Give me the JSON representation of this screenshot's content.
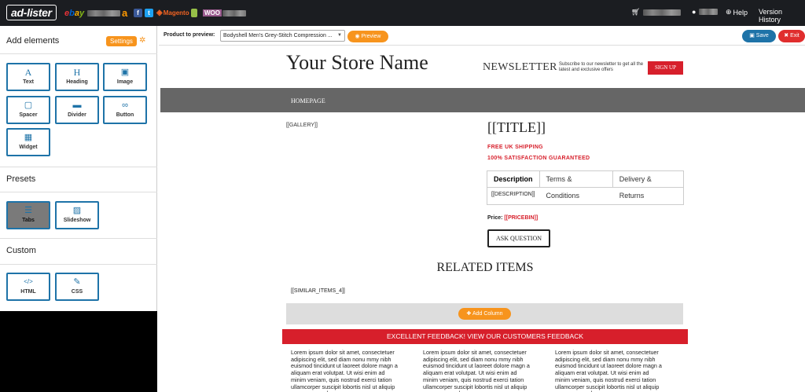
{
  "topbar": {
    "logo": "ad-lister",
    "channels": {
      "ebay": [
        "e",
        "b",
        "a",
        "y"
      ],
      "amazon": "a",
      "magento": "Magento",
      "woo": "WOO"
    },
    "help": "Help",
    "version_history": "Version History"
  },
  "sidebar": {
    "add_elements_title": "Add elements",
    "settings_label": "Settings",
    "elements": [
      {
        "label": "Text",
        "icon": "text-icon",
        "glyph": "A"
      },
      {
        "label": "Heading",
        "icon": "heading-icon",
        "glyph": "H"
      },
      {
        "label": "Image",
        "icon": "camera-icon",
        "glyph": "▣"
      },
      {
        "label": "Spacer",
        "icon": "spacer-icon",
        "glyph": "▢"
      },
      {
        "label": "Divider",
        "icon": "divider-icon",
        "glyph": "▬"
      },
      {
        "label": "Button",
        "icon": "link-icon",
        "glyph": "∞"
      },
      {
        "label": "Widget",
        "icon": "grid-icon",
        "glyph": "▦"
      }
    ],
    "presets_title": "Presets",
    "presets": [
      {
        "label": "Tabs",
        "icon": "tabs-icon",
        "glyph": "☰"
      },
      {
        "label": "Slideshow",
        "icon": "picture-icon",
        "glyph": "▨"
      }
    ],
    "custom_title": "Custom",
    "custom": [
      {
        "label": "HTML",
        "icon": "code-icon",
        "glyph": "</>"
      },
      {
        "label": "CSS",
        "icon": "edit-icon",
        "glyph": "✎"
      }
    ]
  },
  "toolbar": {
    "product_label": "Product to preview:",
    "product_value": "Bodyshell Men's Grey-Stitch Compression ...",
    "preview_label": "Preview",
    "save_label": "Save",
    "exit_label": "Exit"
  },
  "template": {
    "store_name": "Your Store Name",
    "newsletter_title": "NEWSLETTER",
    "newsletter_desc": "Subscribe to our newsletter to get all the latest and exclusive offers",
    "signup_label": "SIGN UP",
    "nav_home": "HOMEPAGE",
    "gallery_tag": "[[GALLERY]]",
    "title_tag": "[[TITLE]]",
    "free_shipping": "FREE UK SHIPPING",
    "guarantee": "100% SATISFACTION GUARANTEED",
    "tabs": [
      "Description",
      "Terms & Conditions",
      "Delivery & Returns"
    ],
    "description_tag": "[[DESCRIPTION]]",
    "price_label": "Price:",
    "price_tag": "[[PRICEBIN]]",
    "ask_label": "ASK QUESTION",
    "related_title": "RELATED ITEMS",
    "similar_tag": "[[SIMILAR_ITEMS_4]]",
    "add_column_label": "Add Column",
    "feedback_banner": "EXCELLENT FEEDBACK! VIEW OUR CUSTOMERS FEEDBACK",
    "lorem": "Lorem ipsum dolor sit amet, consectetuer adipiscing elit, sed diam nonu mmy nibh euismod tincidunt ut laoreet dolore magn a aliquam erat volutpat. Ut wisi enim ad minim veniam, quis nostrud exerci tation ullamcorper suscipit lobortis nisl ut aliquip ex ea commodo"
  },
  "colors": {
    "accent_orange": "#f7941d",
    "primary_blue": "#1e73a8",
    "danger_red": "#d71f2b",
    "topbar_bg": "#1b1d21"
  }
}
